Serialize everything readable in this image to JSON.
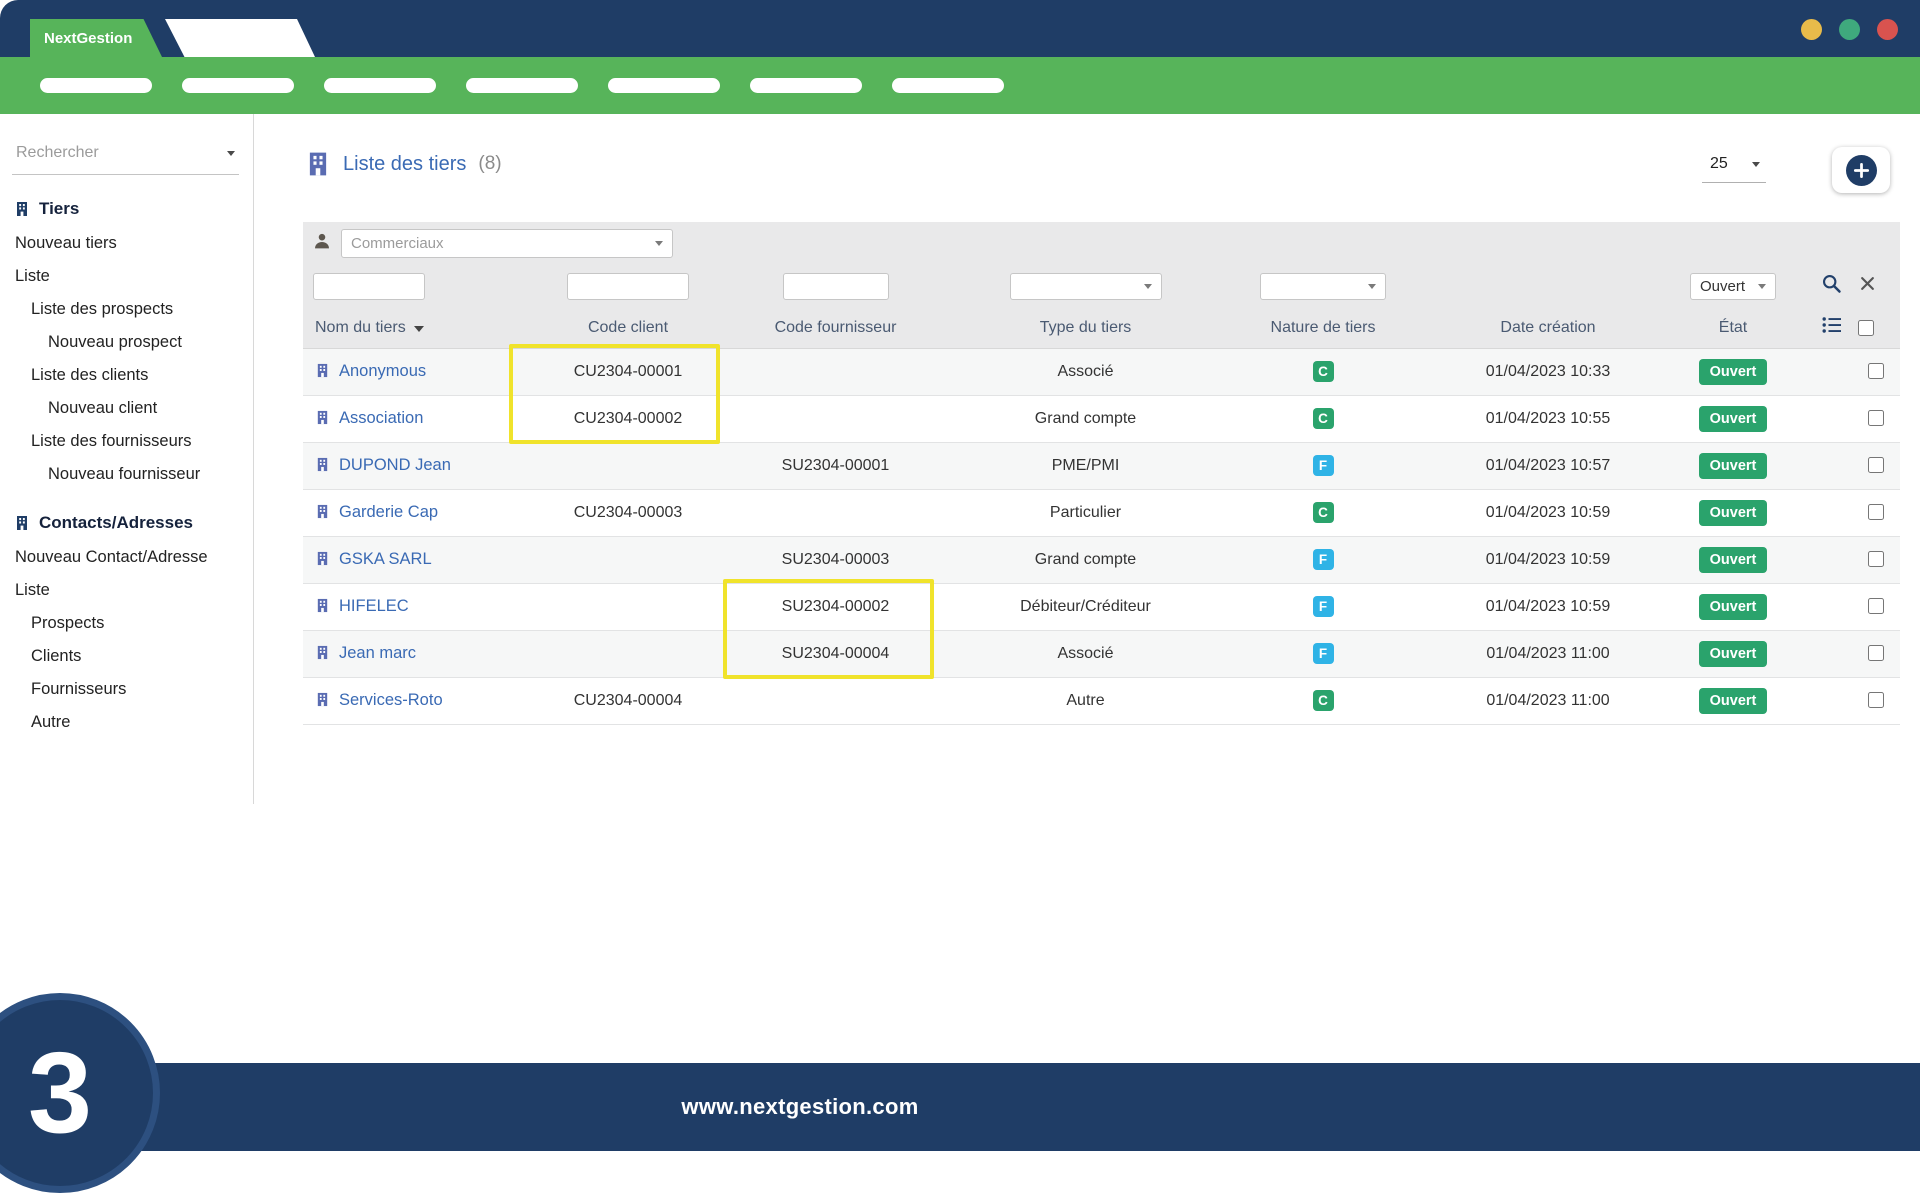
{
  "window": {
    "brand_tab": "NextGestion",
    "traffic_lights": [
      "#e8bb4a",
      "#3fa97d",
      "#d9534f"
    ]
  },
  "navbar": {
    "pill_count": 7
  },
  "sidebar": {
    "search_placeholder": "Rechercher",
    "sections": [
      {
        "label": "Tiers",
        "icon": "building-icon",
        "items": [
          {
            "label": "Nouveau tiers",
            "indent": 0
          },
          {
            "label": "Liste",
            "indent": 0
          },
          {
            "label": "Liste des prospects",
            "indent": 1
          },
          {
            "label": "Nouveau prospect",
            "indent": 2
          },
          {
            "label": "Liste des clients",
            "indent": 1
          },
          {
            "label": "Nouveau client",
            "indent": 2
          },
          {
            "label": "Liste des fournisseurs",
            "indent": 1
          },
          {
            "label": "Nouveau fournisseur",
            "indent": 2
          }
        ]
      },
      {
        "label": "Contacts/Adresses",
        "icon": "building-icon",
        "items": [
          {
            "label": "Nouveau Contact/Adresse",
            "indent": 0
          },
          {
            "label": "Liste",
            "indent": 0
          },
          {
            "label": "Prospects",
            "indent": 1
          },
          {
            "label": "Clients",
            "indent": 1
          },
          {
            "label": "Fournisseurs",
            "indent": 1
          },
          {
            "label": "Autre",
            "indent": 1
          }
        ]
      }
    ]
  },
  "main": {
    "title": "Liste des tiers",
    "count": "(8)",
    "page_size": "25",
    "filters": {
      "commerciaux_placeholder": "Commerciaux",
      "etat_value": "Ouvert"
    },
    "table": {
      "columns": [
        "Nom du tiers",
        "Code client",
        "Code fournisseur",
        "Type du tiers",
        "Nature de tiers",
        "Date création",
        "État"
      ],
      "rows": [
        {
          "name": "Anonymous",
          "code_client": "CU2304-00001",
          "code_fournisseur": "",
          "type": "Associé",
          "nature": "C",
          "date": "01/04/2023 10:33",
          "etat": "Ouvert"
        },
        {
          "name": "Association",
          "code_client": "CU2304-00002",
          "code_fournisseur": "",
          "type": "Grand compte",
          "nature": "C",
          "date": "01/04/2023 10:55",
          "etat": "Ouvert"
        },
        {
          "name": "DUPOND Jean",
          "code_client": "",
          "code_fournisseur": "SU2304-00001",
          "type": "PME/PMI",
          "nature": "F",
          "date": "01/04/2023 10:57",
          "etat": "Ouvert"
        },
        {
          "name": "Garderie Cap",
          "code_client": "CU2304-00003",
          "code_fournisseur": "",
          "type": "Particulier",
          "nature": "C",
          "date": "01/04/2023 10:59",
          "etat": "Ouvert"
        },
        {
          "name": "GSKA SARL",
          "code_client": "",
          "code_fournisseur": "SU2304-00003",
          "type": "Grand compte",
          "nature": "F",
          "date": "01/04/2023 10:59",
          "etat": "Ouvert"
        },
        {
          "name": "HIFELEC",
          "code_client": "",
          "code_fournisseur": "SU2304-00002",
          "type": "Débiteur/Créditeur",
          "nature": "F",
          "date": "01/04/2023 10:59",
          "etat": "Ouvert"
        },
        {
          "name": "Jean marc",
          "code_client": "",
          "code_fournisseur": "SU2304-00004",
          "type": "Associé",
          "nature": "F",
          "date": "01/04/2023 11:00",
          "etat": "Ouvert"
        },
        {
          "name": "Services-Roto",
          "code_client": "CU2304-00004",
          "code_fournisseur": "",
          "type": "Autre",
          "nature": "C",
          "date": "01/04/2023 11:00",
          "etat": "Ouvert"
        }
      ]
    },
    "badges": {
      "etat_color": "#2aa36c",
      "nature_colors": {
        "C": "#2aa36c",
        "F": "#2fb3e6"
      }
    },
    "accent_colors": {
      "link_blue": "#3a6ab4",
      "navy": "#1f3d66",
      "green": "#57b45a"
    }
  },
  "annotations": {
    "highlight_color": "#f0e32b",
    "highlighted_values": [
      "CU2304-00001",
      "CU2304-00002",
      "SU2304-00002",
      "SU2304-00004"
    ]
  },
  "footer": {
    "url": "www.nextgestion.com",
    "step_number": "3"
  }
}
